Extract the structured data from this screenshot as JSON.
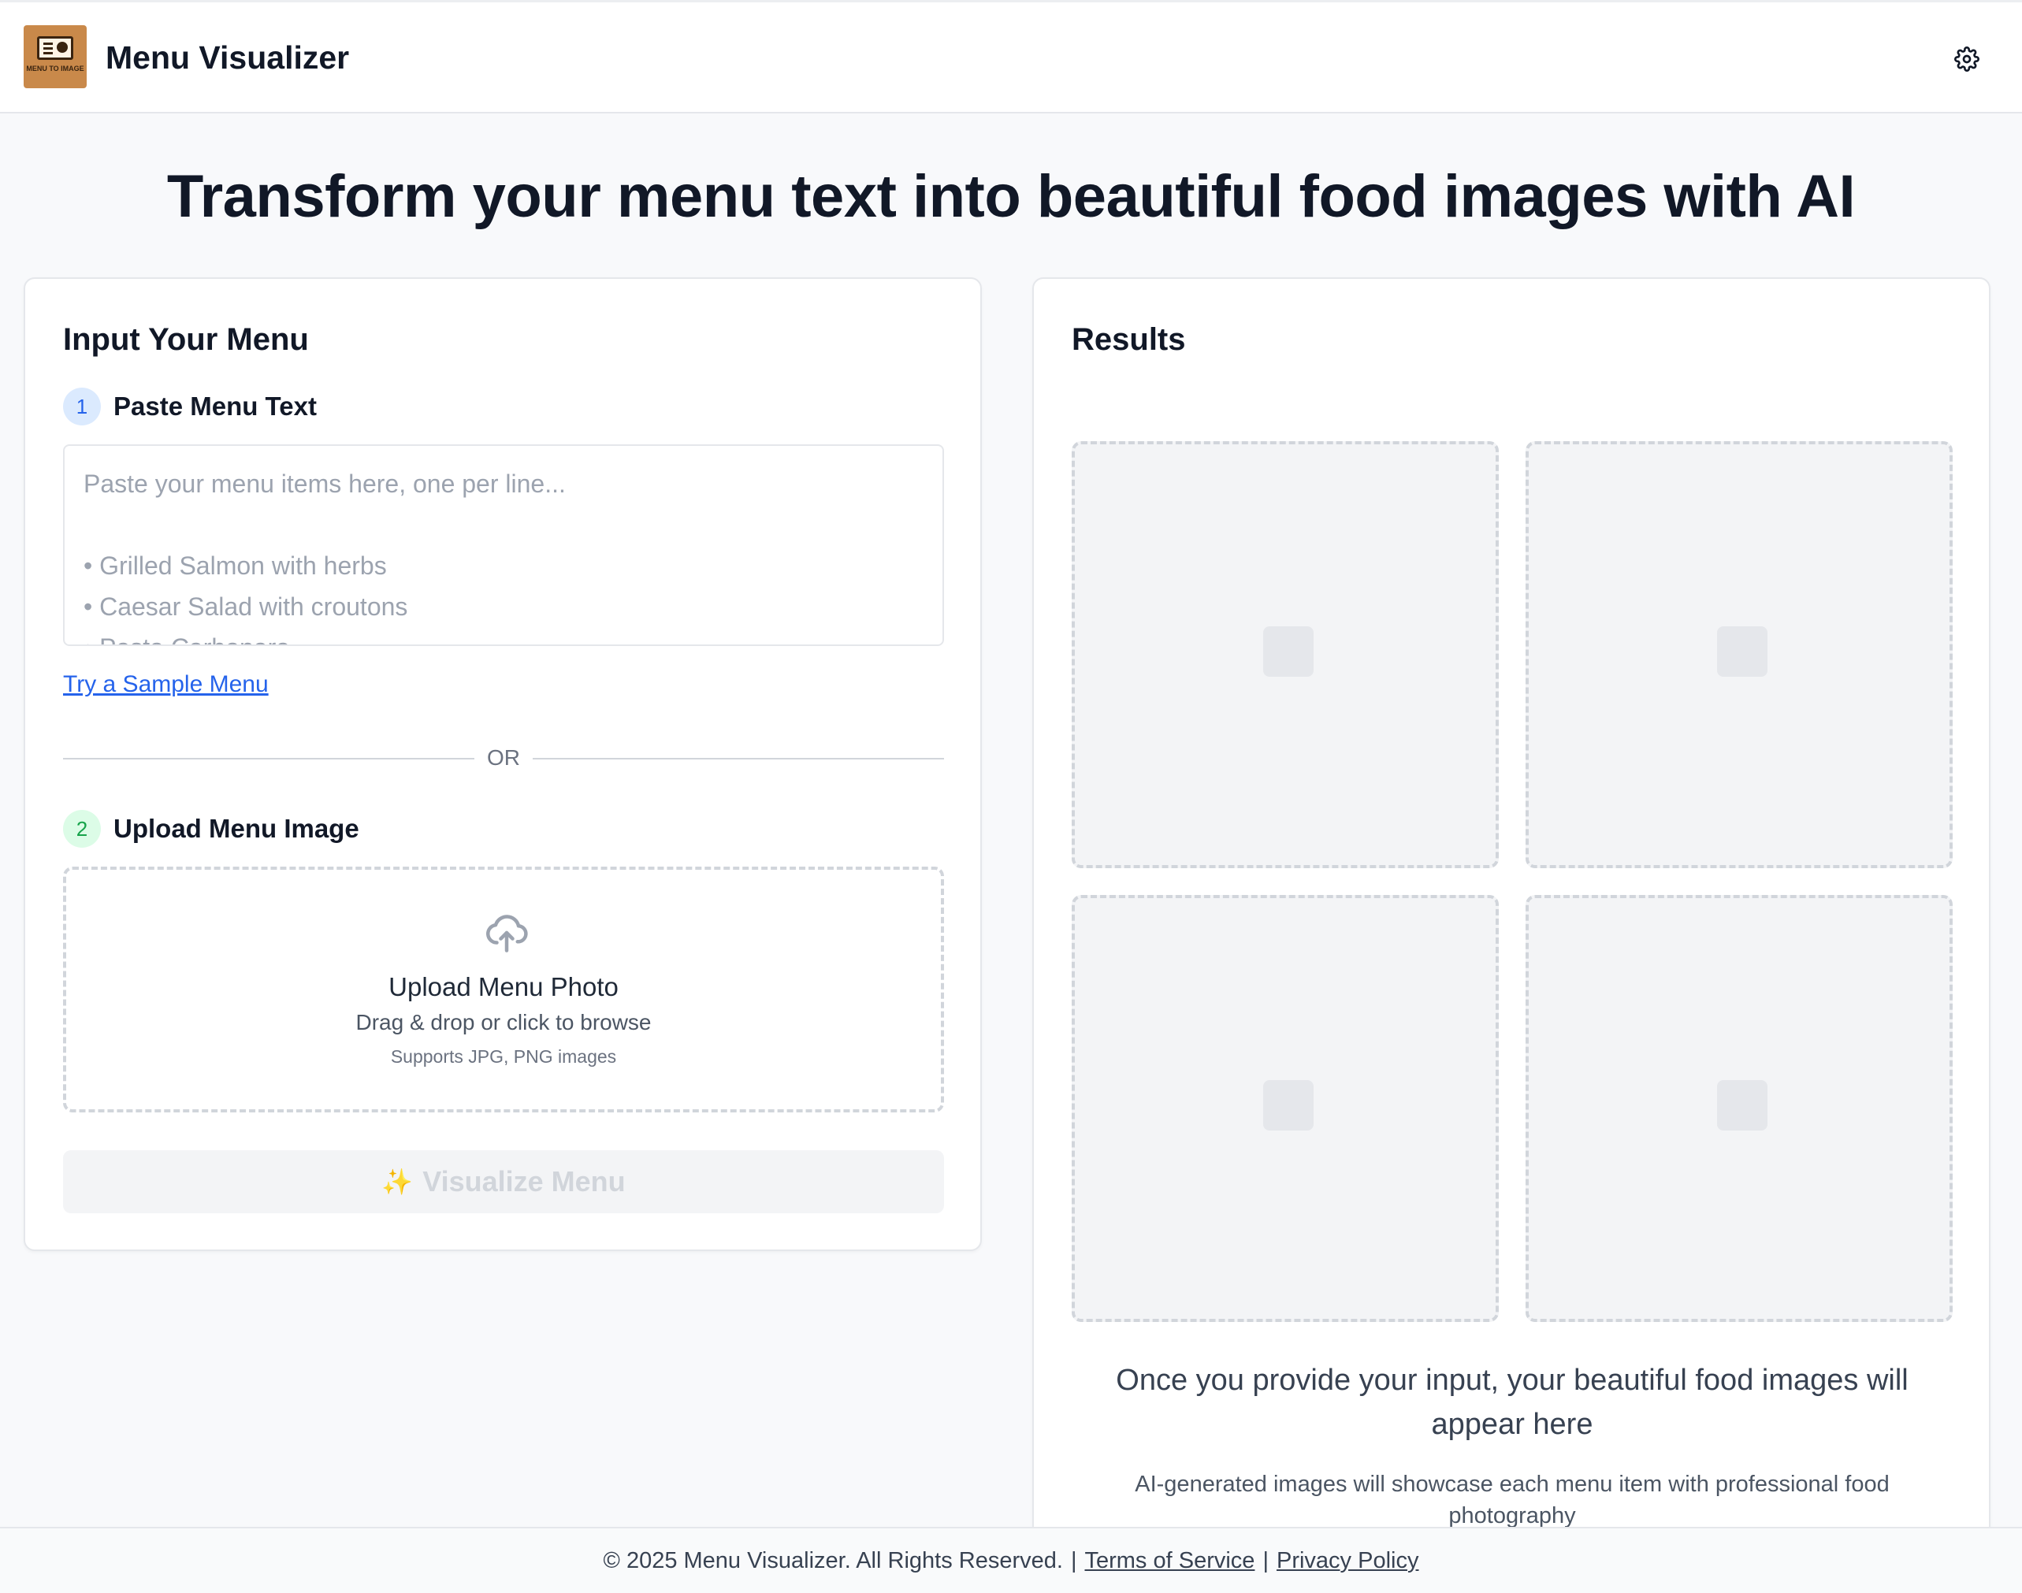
{
  "header": {
    "logo_text": "MENU TO IMAGE",
    "title": "Menu Visualizer",
    "settings_icon": "gear-icon"
  },
  "hero": {
    "title": "Transform your menu text into beautiful food images with AI"
  },
  "input_card": {
    "title": "Input Your Menu",
    "step1": {
      "number": "1",
      "label": "Paste Menu Text"
    },
    "textarea": {
      "placeholder_lines": [
        "Paste your menu items here, one per line...",
        "",
        "• Grilled Salmon with herbs",
        "• Caesar Salad with croutons",
        "• Pasta Carbonara"
      ]
    },
    "sample_link": "Try a Sample Menu",
    "divider": "OR",
    "step2": {
      "number": "2",
      "label": "Upload Menu Image"
    },
    "dropzone": {
      "icon": "upload-cloud-icon",
      "title": "Upload Menu Photo",
      "subtitle": "Drag & drop or click to browse",
      "note": "Supports JPG, PNG images"
    },
    "visualize_button": {
      "icon": "✨",
      "label": "Visualize Menu"
    }
  },
  "results_card": {
    "title": "Results",
    "placeholder_count": 4,
    "message": "Once you provide your input, your beautiful food images will appear here",
    "sub_message": "AI-generated images will showcase each menu item with professional food photography"
  },
  "footer": {
    "copyright": "© 2025 Menu Visualizer. All Rights Reserved.",
    "separator": "|",
    "terms": "Terms of Service",
    "privacy": "Privacy Policy"
  },
  "colors": {
    "accent": "#2563eb",
    "step2_accent": "#16a34a",
    "logo_bg": "#c9894a",
    "page_bg": "#f8f9fb"
  }
}
